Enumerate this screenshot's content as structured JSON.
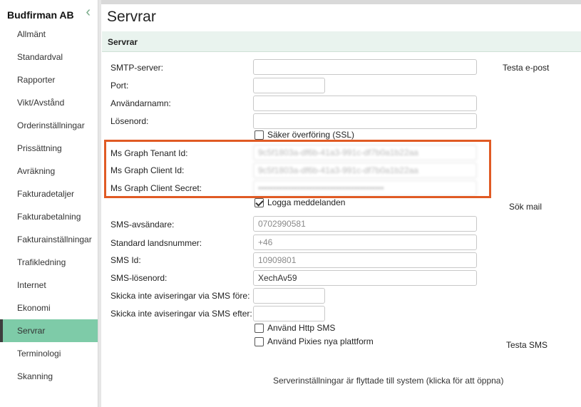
{
  "sidebar": {
    "company": "Budfirman AB",
    "collapse_icon": "chevron-left-icon",
    "items": [
      {
        "label": "Allmänt"
      },
      {
        "label": "Standardval"
      },
      {
        "label": "Rapporter"
      },
      {
        "label": "Vikt/Avstånd"
      },
      {
        "label": "Orderinställningar"
      },
      {
        "label": "Prissättning"
      },
      {
        "label": "Avräkning"
      },
      {
        "label": "Fakturadetaljer"
      },
      {
        "label": "Fakturabetalning"
      },
      {
        "label": "Fakturainställningar"
      },
      {
        "label": "Trafikledning"
      },
      {
        "label": "Internet"
      },
      {
        "label": "Ekonomi"
      },
      {
        "label": "Servrar",
        "active": true
      },
      {
        "label": "Terminologi"
      },
      {
        "label": "Skanning"
      }
    ],
    "active_color": "#7ecba8"
  },
  "page": {
    "title": "Servrar",
    "section": "Servrar"
  },
  "form": {
    "smtp_server_label": "SMTP-server:",
    "smtp_server_value": "",
    "port_label": "Port:",
    "port_value": "",
    "username_label": "Användarnamn:",
    "username_value": "",
    "password_label": "Lösenord:",
    "password_value": "",
    "ssl_label": "Säker överföring (SSL)",
    "ssl_checked": false,
    "tenant_label": "Ms Graph Tenant Id:",
    "tenant_value": "9c5f1803a-df6b-41a3-991c-df7b0a1b22aa",
    "client_label": "Ms Graph Client Id:",
    "client_value": "9c5f1803a-df6b-41a3-991c-df7b0a1b22aa",
    "secret_label": "Ms Graph Client Secret:",
    "secret_value": "••••••••••••••••••••••••••••••••••••••••••",
    "log_label": "Logga meddelanden",
    "log_checked": true,
    "sms_sender_label": "SMS-avsändare:",
    "sms_sender_value": "0702990581",
    "country_code_label": "Standard landsnummer:",
    "country_code_value": "+46",
    "sms_id_label": "SMS Id:",
    "sms_id_value": "10909801",
    "sms_password_label": "SMS-lösenord:",
    "sms_password_value": "XechAv59",
    "no_sms_before_label": "Skicka inte aviseringar via SMS före:",
    "no_sms_before_value": "",
    "no_sms_after_label": "Skicka inte aviseringar via SMS efter:",
    "no_sms_after_value": "",
    "http_sms_label": "Använd Http SMS",
    "http_sms_checked": false,
    "pixies_label": "Använd Pixies nya plattform",
    "pixies_checked": false
  },
  "actions": {
    "test_email": "Testa e-post",
    "search_mail": "Sök mail",
    "test_sms": "Testa SMS",
    "server_moved": "Serverinställningar är flyttade till system (klicka för att öppna)"
  },
  "highlight_color": "#e05a24"
}
